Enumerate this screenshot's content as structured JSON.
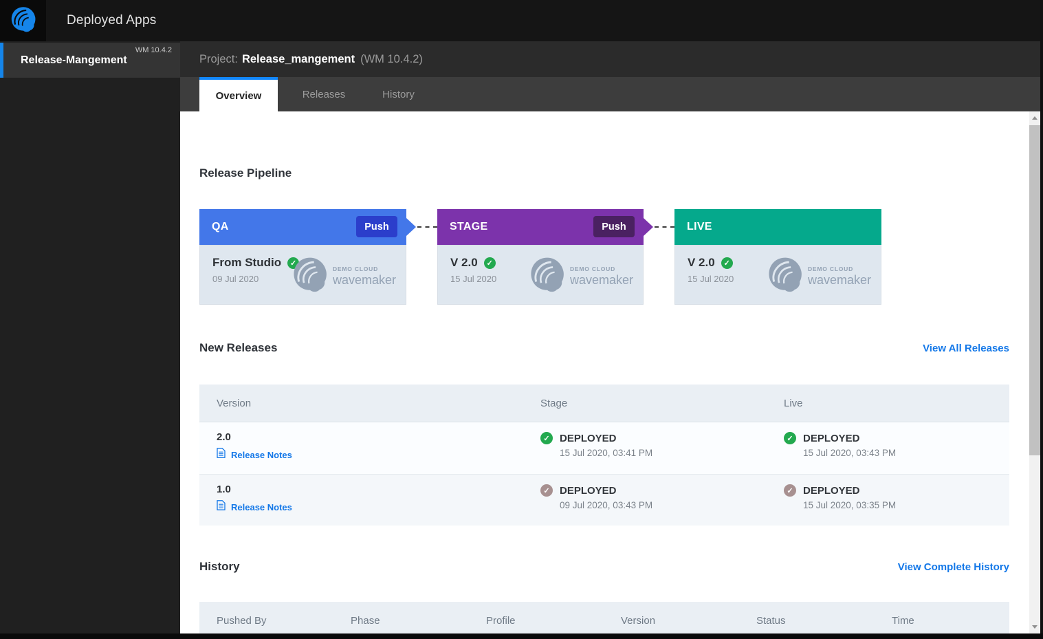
{
  "colors": {
    "accent_blue": "#1585ea",
    "link_blue": "#1478e8",
    "tab_active_border": "#1287fb",
    "qa_header": "#4377e9",
    "qa_push": "#2b3ecb",
    "stage_header": "#7c33ab",
    "stage_push": "#4a2161",
    "live_header": "#05a98c",
    "check_green": "#23a94f",
    "check_muted": "#a79090"
  },
  "topbar": {
    "title": "Deployed Apps"
  },
  "sidebar": {
    "app_name": "Release-Mangement",
    "app_version": "WM 10.4.2"
  },
  "project_header": {
    "label": "Project:",
    "name": "Release_mangement",
    "version": "(WM 10.4.2)"
  },
  "tabs": [
    {
      "label": "Overview"
    },
    {
      "label": "Releases"
    },
    {
      "label": "History"
    }
  ],
  "pipeline": {
    "title": "Release Pipeline",
    "stages": [
      {
        "name": "QA",
        "push": "Push",
        "version": "From Studio",
        "date": "09 Jul 2020",
        "brand_top": "DEMO CLOUD",
        "brand_bottom": "wavemaker"
      },
      {
        "name": "STAGE",
        "push": "Push",
        "version": "V 2.0",
        "date": "15 Jul 2020",
        "brand_top": "DEMO CLOUD",
        "brand_bottom": "wavemaker"
      },
      {
        "name": "LIVE",
        "version": "V 2.0",
        "date": "15 Jul 2020",
        "brand_top": "DEMO CLOUD",
        "brand_bottom": "wavemaker"
      }
    ]
  },
  "new_releases": {
    "title": "New Releases",
    "link": "View All Releases",
    "columns": [
      "Version",
      "Stage",
      "Live"
    ],
    "rows": [
      {
        "version": "2.0",
        "notes": "Release Notes",
        "stage_status": "DEPLOYED",
        "stage_time": "15 Jul 2020, 03:41 PM",
        "live_status": "DEPLOYED",
        "live_time": "15 Jul 2020, 03:43 PM"
      },
      {
        "version": "1.0",
        "notes": "Release Notes",
        "stage_status": "DEPLOYED",
        "stage_time": "09 Jul 2020, 03:43 PM",
        "live_status": "DEPLOYED",
        "live_time": "15 Jul 2020, 03:35 PM"
      }
    ]
  },
  "history": {
    "title": "History",
    "link": "View Complete History",
    "columns": [
      "Pushed By",
      "Phase",
      "Profile",
      "Version",
      "Status",
      "Time"
    ]
  },
  "check_glyph": "✓"
}
